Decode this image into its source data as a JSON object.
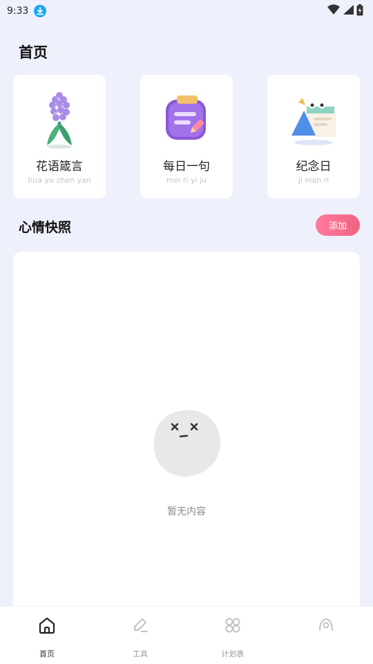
{
  "status_bar": {
    "time": "9:33"
  },
  "header": {
    "title": "首页"
  },
  "cards": [
    {
      "title": "花语箴言",
      "pinyin": "hua yu zhen yan"
    },
    {
      "title": "每日一句",
      "pinyin": "mei ri yi ju"
    },
    {
      "title": "纪念日",
      "pinyin": "ji nian ri"
    }
  ],
  "mood": {
    "title": "心情快照",
    "add_label": "添加",
    "empty_text": "暂无内容"
  },
  "bottom_nav": [
    {
      "label": "首页",
      "icon": "home-icon",
      "active": true
    },
    {
      "label": "工具",
      "icon": "edit-icon",
      "active": false
    },
    {
      "label": "计划表",
      "icon": "grid-icon",
      "active": false
    },
    {
      "label": "",
      "icon": "profile-icon",
      "active": false
    }
  ],
  "colors": {
    "background": "#eef0fc",
    "accent": "#f0637f",
    "download": "#1aa7f0"
  }
}
